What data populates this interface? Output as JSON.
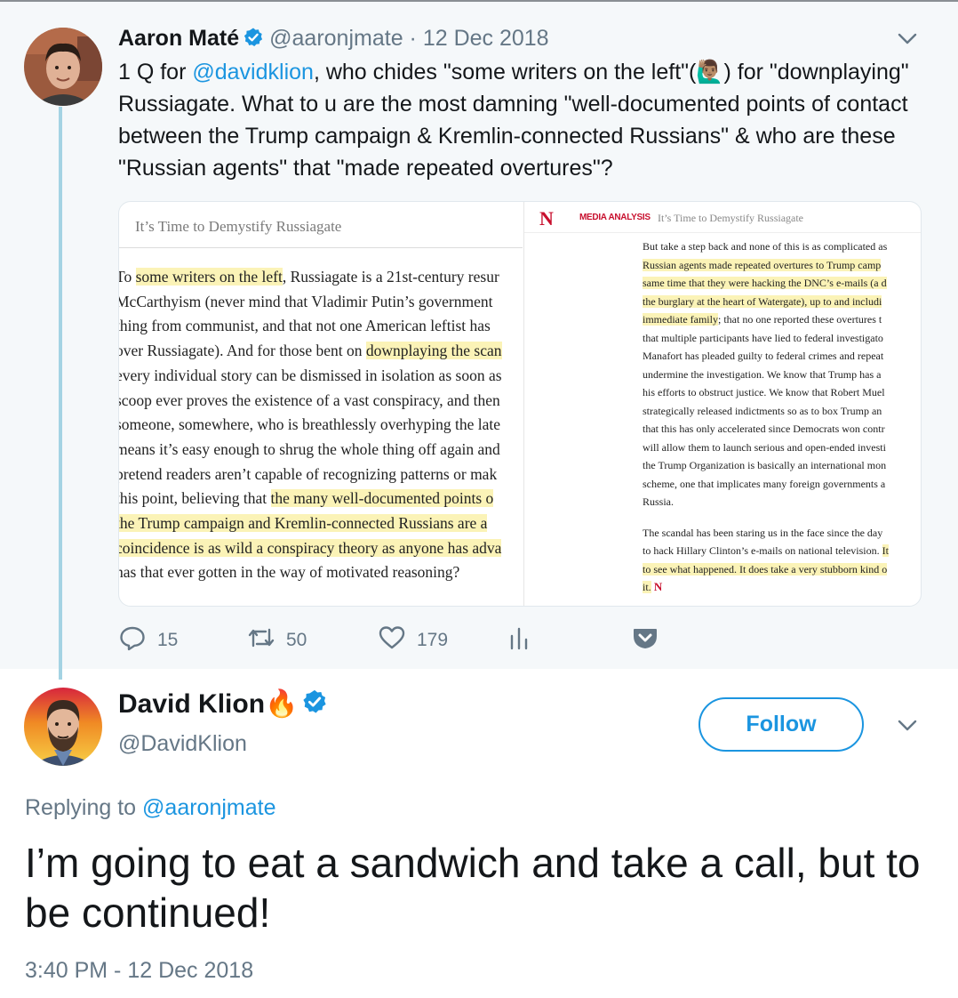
{
  "parent_tweet": {
    "name": "Aaron Maté",
    "handle": "@aaronjmate",
    "date": "12 Dec 2018",
    "text_before_mention": "1 Q for ",
    "mention": "@davidklion",
    "text_line1_after": ", who chides \"some writers on the left\"(",
    "emoji": "🙋🏽‍♂️",
    "text_line1_end": ") for",
    "text_rest": "\"downplaying\" Russiagate. What to u are the most damning \"well-documented points of contact between the Trump campaign & Kremlin-connected Russians\" & who are these \"Russian agents\" that \"made repeated overtures\"?",
    "card": {
      "left": {
        "title": "It’s Time to Demystify Russiagate",
        "lines": [
          {
            "pre": "To ",
            "hl": "some writers on the left",
            "post": ", Russiagate is a 21st-century resur"
          },
          {
            "pre": "McCarthyism (never mind that Vladimir Putin’s government",
            "hl": "",
            "post": ""
          },
          {
            "pre": "thing from communist, and that not one American leftist has",
            "hl": "",
            "post": ""
          },
          {
            "pre": "over Russiagate). And for those bent on ",
            "hl": "downplaying the scan",
            "post": ""
          },
          {
            "pre": "every individual story can be dismissed in isolation as soon as",
            "hl": "",
            "post": ""
          },
          {
            "pre": "scoop ever proves the existence of a vast conspiracy, and then",
            "hl": "",
            "post": ""
          },
          {
            "pre": "someone, somewhere, who is breathlessly overhyping the late",
            "hl": "",
            "post": ""
          },
          {
            "pre": "means it’s easy enough to shrug the whole thing off again and",
            "hl": "",
            "post": ""
          },
          {
            "pre": "pretend readers aren’t capable of recognizing patterns or mak",
            "hl": "",
            "post": ""
          },
          {
            "pre": "this point, believing that ",
            "hl": "the many well-documented points o",
            "post": ""
          },
          {
            "pre": "",
            "hl": "the Trump campaign and Kremlin-connected Russians are a",
            "post": ""
          },
          {
            "pre": "",
            "hl": "coincidence is as wild a conspiracy theory as anyone has adva",
            "post": ""
          },
          {
            "pre": "has that ever gotten in the way of motivated reasoning?",
            "hl": "",
            "post": ""
          }
        ]
      },
      "right": {
        "logo": "N",
        "section": "MEDIA ANALYSIS",
        "title": "It’s Time to Demystify Russiagate",
        "para1": [
          {
            "pre": "But take a step back and none of this is as complicated as",
            "hl": "",
            "post": ""
          },
          {
            "pre": "",
            "hl": "Russian agents made repeated overtures to Trump camp",
            "post": ""
          },
          {
            "pre": "",
            "hl": "same time that they were hacking the DNC’s e-mails (a d",
            "post": ""
          },
          {
            "pre": "",
            "hl": "the burglary at the heart of Watergate), up to and includi",
            "post": ""
          },
          {
            "pre": "",
            "hl": "immediate family",
            "post": "; that no one reported these overtures t"
          },
          {
            "pre": "that multiple participants have lied to federal investigato",
            "hl": "",
            "post": ""
          },
          {
            "pre": "Manafort has pleaded guilty to federal crimes and repeat",
            "hl": "",
            "post": ""
          },
          {
            "pre": "undermine the investigation. We know that Trump has a",
            "hl": "",
            "post": ""
          },
          {
            "pre": "his efforts to obstruct justice. We know that Robert Muel",
            "hl": "",
            "post": ""
          },
          {
            "pre": "strategically released indictments so as to box Trump an",
            "hl": "",
            "post": ""
          },
          {
            "pre": "that this has only accelerated since Democrats won contr",
            "hl": "",
            "post": ""
          },
          {
            "pre": "will allow them to launch serious and open-ended investi",
            "hl": "",
            "post": ""
          },
          {
            "pre": "the Trump Organization is basically an international mon",
            "hl": "",
            "post": ""
          },
          {
            "pre": "scheme, one that implicates many foreign governments a",
            "hl": "",
            "post": ""
          },
          {
            "pre": "Russia.",
            "hl": "",
            "post": ""
          }
        ],
        "para2": [
          {
            "pre": "The scandal has been staring us in the face since the day",
            "hl": "",
            "post": ""
          },
          {
            "pre": "to hack Hillary Clinton’s e-mails on national television. ",
            "hl": "It",
            "post": ""
          },
          {
            "pre": "",
            "hl": "to see what happened. It does take a very stubborn kind o",
            "post": ""
          },
          {
            "pre": "",
            "hl": "it.",
            "post": ""
          }
        ],
        "end_mark": "N"
      }
    },
    "actions": {
      "replies": "15",
      "retweets": "50",
      "likes": "179"
    }
  },
  "reply_tweet": {
    "name": "David Klion",
    "name_emoji": "🔥",
    "handle": "@DavidKlion",
    "follow_label": "Follow",
    "replying_prefix": "Replying to ",
    "replying_to": "@aaronjmate",
    "text": "I’m going to eat a sandwich and take a call, but to be continued!",
    "timestamp": "3:40 PM - 12 Dec 2018"
  },
  "colors": {
    "accent": "#1b95e0",
    "highlight": "#fbf3b7",
    "parent_bg": "#f5f8fa",
    "thread_line": "#a4d3e3"
  }
}
